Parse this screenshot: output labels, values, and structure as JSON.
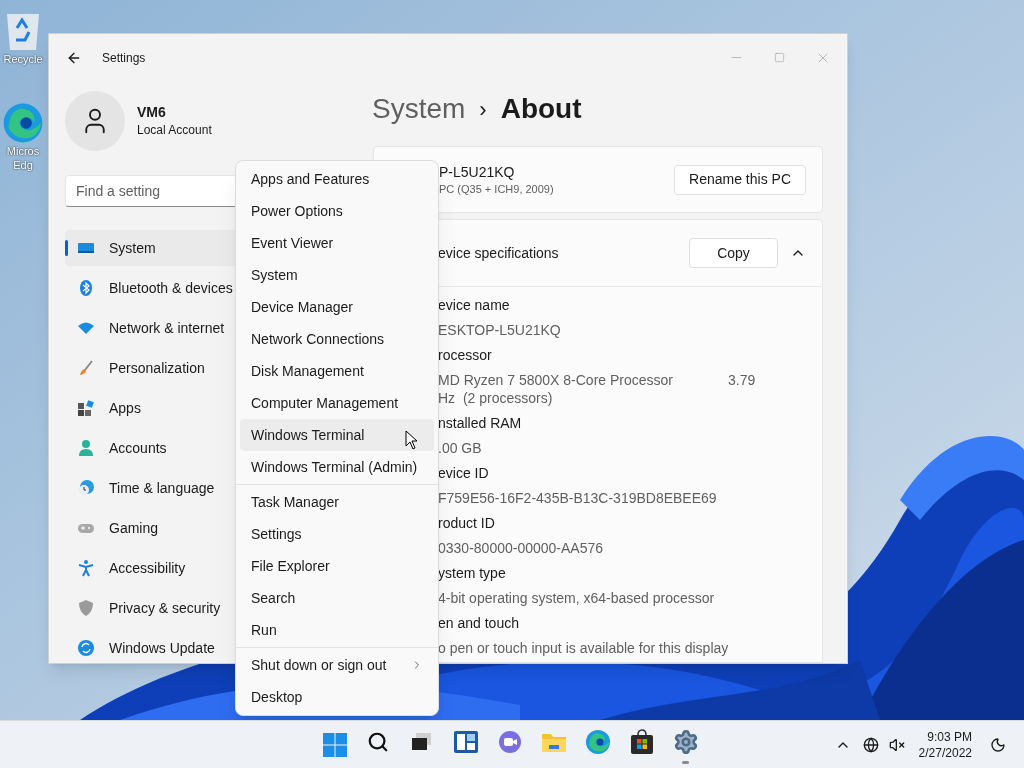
{
  "desktop": {
    "icons": [
      {
        "label_lines": [
          "Recycle"
        ]
      },
      {
        "label_lines": [
          "Micros",
          "Edg"
        ]
      }
    ]
  },
  "window": {
    "title": "Settings",
    "profile": {
      "name": "VM6",
      "account": "Local Account"
    },
    "search": {
      "placeholder": "Find a setting"
    },
    "sidebar": {
      "items": [
        {
          "label": "System",
          "selected": true
        },
        {
          "label": "Bluetooth & devices",
          "selected": false
        },
        {
          "label": "Network & internet",
          "selected": false
        },
        {
          "label": "Personalization",
          "selected": false
        },
        {
          "label": "Apps",
          "selected": false
        },
        {
          "label": "Accounts",
          "selected": false
        },
        {
          "label": "Time & language",
          "selected": false
        },
        {
          "label": "Gaming",
          "selected": false
        },
        {
          "label": "Accessibility",
          "selected": false
        },
        {
          "label": "Privacy & security",
          "selected": false
        },
        {
          "label": "Windows Update",
          "selected": false
        }
      ]
    },
    "breadcrumb": {
      "parent": "System",
      "separator": "›",
      "current": "About"
    },
    "pc_card": {
      "name": "P-L5U21KQ",
      "model": "PC (Q35 + ICH9, 2009)",
      "button": "Rename this PC"
    },
    "specs_card": {
      "title": "evice specifications",
      "button": "Copy",
      "expanded": true,
      "rows": [
        {
          "label": "evice name",
          "value": "ESKTOP-L5U21KQ"
        },
        {
          "label": "rocessor",
          "value": "MD Ryzen 7 5800X 8-Core Processor",
          "value_extra": "3.79",
          "value_cont": "Hz  (2 processors)"
        },
        {
          "label": "nstalled RAM",
          "value": ".00 GB"
        },
        {
          "label": "evice ID",
          "value": "F759E56-16F2-435B-B13C-319BD8EBEE69"
        },
        {
          "label": "roduct ID",
          "value": "0330-80000-00000-AA576"
        },
        {
          "label": "ystem type",
          "value": "4-bit operating system, x64-based processor"
        },
        {
          "label": "en and touch",
          "value": "o pen or touch input is available for this display"
        }
      ]
    }
  },
  "context_menu": {
    "groups": [
      [
        {
          "label": "Apps and Features",
          "hovered": false,
          "has_submenu": false
        },
        {
          "label": "Power Options",
          "hovered": false,
          "has_submenu": false
        },
        {
          "label": "Event Viewer",
          "hovered": false,
          "has_submenu": false
        },
        {
          "label": "System",
          "hovered": false,
          "has_submenu": false
        },
        {
          "label": "Device Manager",
          "hovered": false,
          "has_submenu": false
        },
        {
          "label": "Network Connections",
          "hovered": false,
          "has_submenu": false
        },
        {
          "label": "Disk Management",
          "hovered": false,
          "has_submenu": false
        },
        {
          "label": "Computer Management",
          "hovered": false,
          "has_submenu": false
        },
        {
          "label": "Windows Terminal",
          "hovered": true,
          "has_submenu": false
        },
        {
          "label": "Windows Terminal (Admin)",
          "hovered": false,
          "has_submenu": false
        }
      ],
      [
        {
          "label": "Task Manager",
          "hovered": false,
          "has_submenu": false
        },
        {
          "label": "Settings",
          "hovered": false,
          "has_submenu": false
        },
        {
          "label": "File Explorer",
          "hovered": false,
          "has_submenu": false
        },
        {
          "label": "Search",
          "hovered": false,
          "has_submenu": false
        },
        {
          "label": "Run",
          "hovered": false,
          "has_submenu": false
        }
      ],
      [
        {
          "label": "Shut down or sign out",
          "hovered": false,
          "has_submenu": true
        },
        {
          "label": "Desktop",
          "hovered": false,
          "has_submenu": false
        }
      ]
    ]
  },
  "taskbar": {
    "apps": [
      {
        "running": false
      },
      {
        "running": false
      },
      {
        "running": false
      },
      {
        "running": false
      },
      {
        "running": false
      },
      {
        "running": false
      },
      {
        "running": false
      },
      {
        "running": true
      }
    ],
    "clock": {
      "time": "9:03 PM",
      "date": "2/27/2022"
    }
  }
}
